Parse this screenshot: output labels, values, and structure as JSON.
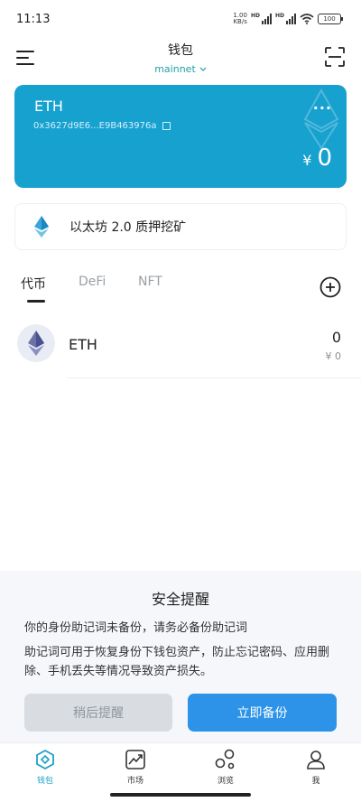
{
  "status_bar": {
    "time": "11:13",
    "net_speed_value": "1.00",
    "net_speed_unit": "KB/s",
    "hd_label": "HD",
    "battery": "100"
  },
  "header": {
    "title": "钱包",
    "network": "mainnet"
  },
  "wallet_card": {
    "name": "ETH",
    "address": "0x3627d9E6...E9B463976a",
    "more": "···",
    "currency": "¥",
    "balance": "0",
    "color": "#17a1cf"
  },
  "staking": {
    "label": "以太坊 2.0 质押挖矿"
  },
  "tabs": [
    {
      "label": "代币",
      "active": true
    },
    {
      "label": "DeFi",
      "active": false
    },
    {
      "label": "NFT",
      "active": false
    }
  ],
  "tokens": [
    {
      "name": "ETH",
      "amount": "0",
      "value": "¥ 0",
      "icon": "ethereum-icon"
    }
  ],
  "reminder": {
    "title": "安全提醒",
    "line1": "你的身份助记词未备份，请务必备份助记词",
    "line2": "助记词可用于恢复身份下钱包资产，防止忘记密码、应用删除、手机丢失等情况导致资产损失。",
    "later_button": "稍后提醒",
    "backup_button": "立即备份",
    "accent": "#2c93e8"
  },
  "bottom_nav": [
    {
      "label": "钱包",
      "icon": "wallet-icon",
      "active": true
    },
    {
      "label": "市场",
      "icon": "market-icon",
      "active": false
    },
    {
      "label": "浏览",
      "icon": "browse-icon",
      "active": false
    },
    {
      "label": "我",
      "icon": "profile-icon",
      "active": false
    }
  ]
}
